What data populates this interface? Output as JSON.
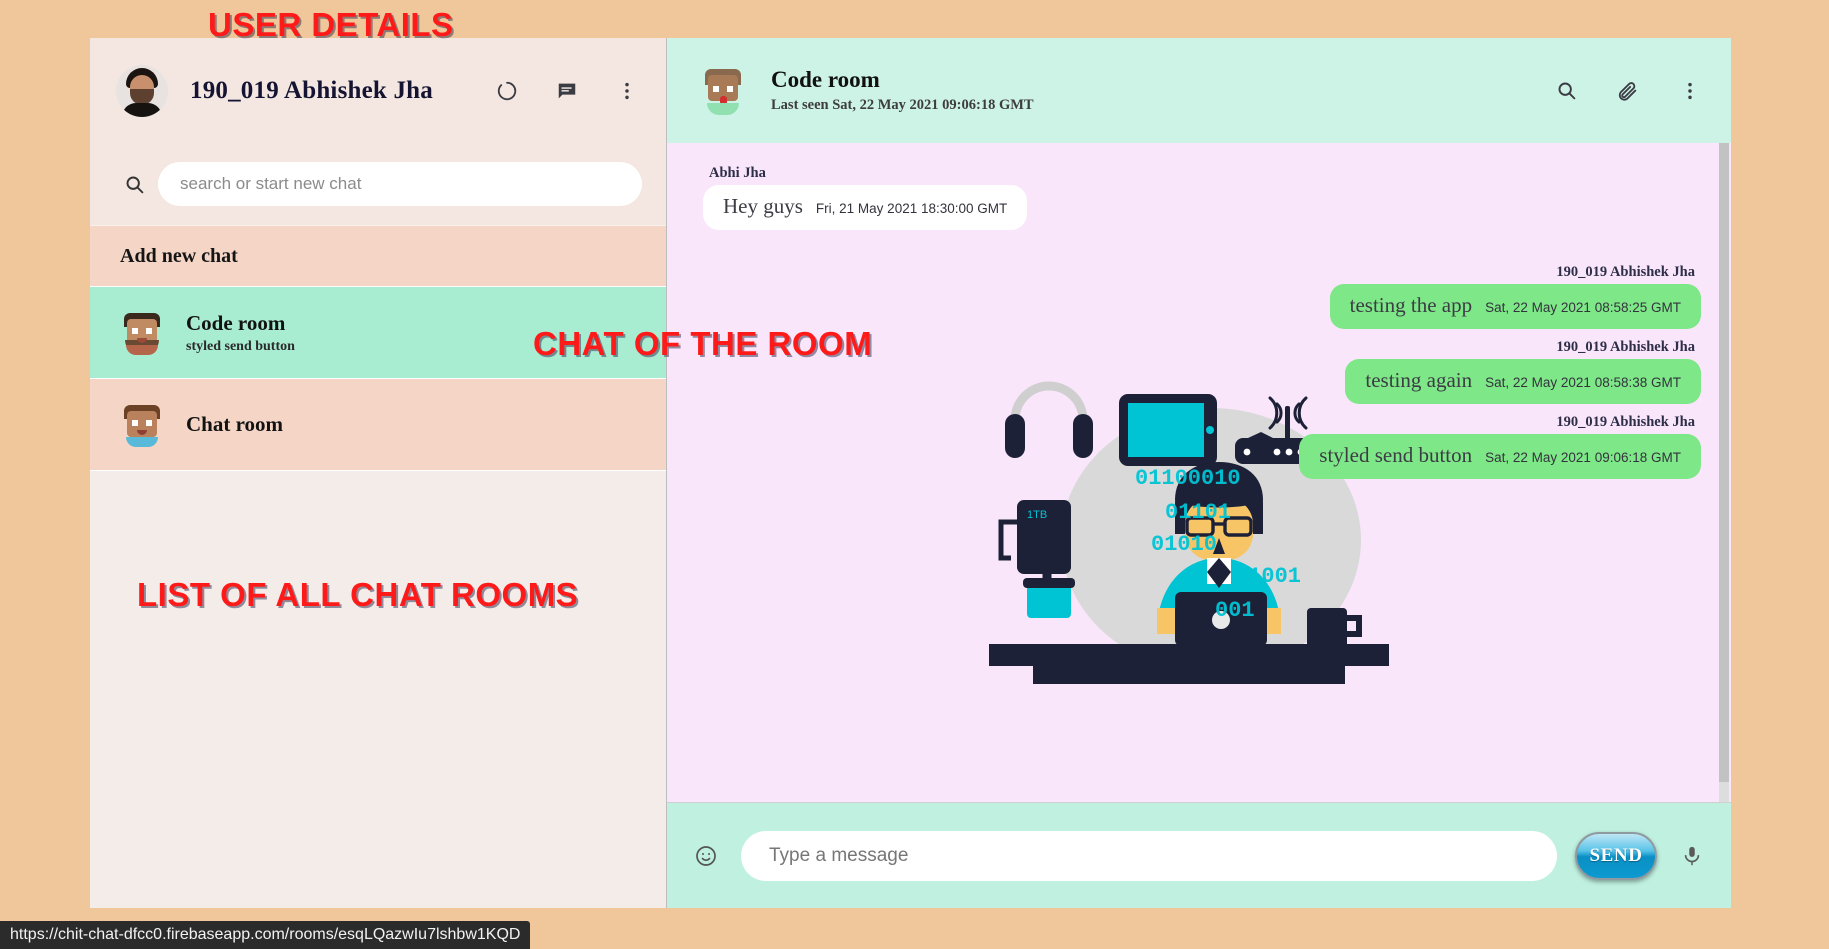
{
  "sidebar": {
    "user": {
      "name": "190_019 Abhishek Jha",
      "avatar_icon": "user-photo-avatar"
    },
    "header_icons": [
      {
        "name": "status-ring-icon",
        "glyph": "status-ring"
      },
      {
        "name": "chat-icon",
        "glyph": "chat-bubble"
      },
      {
        "name": "more-options-icon",
        "glyph": "three-dots-vertical"
      }
    ],
    "search": {
      "placeholder": "search or start new chat",
      "value": "",
      "icon": "search-icon"
    },
    "add_new_chat_label": "Add new chat",
    "rooms": [
      {
        "name": "Code room",
        "subtitle": "styled send button",
        "active": true
      },
      {
        "name": "Chat room",
        "subtitle": "",
        "active": false
      }
    ]
  },
  "chat": {
    "title": "Code room",
    "last_seen": "Last seen Sat, 22 May 2021 09:06:18 GMT",
    "header_icons": [
      {
        "name": "search-icon",
        "glyph": "magnifier"
      },
      {
        "name": "attachment-icon",
        "glyph": "paperclip"
      },
      {
        "name": "more-options-icon",
        "glyph": "three-dots-vertical"
      }
    ],
    "messages": [
      {
        "sender": "Abhi Jha",
        "text": "Hey guys",
        "time": "Fri, 21 May 2021 18:30:00 GMT",
        "direction": "in"
      },
      {
        "sender": "190_019 Abhishek Jha",
        "text": "testing the app",
        "time": "Sat, 22 May 2021 08:58:25 GMT",
        "direction": "out"
      },
      {
        "sender": "190_019 Abhishek Jha",
        "text": "testing again",
        "time": "Sat, 22 May 2021 08:58:38 GMT",
        "direction": "out"
      },
      {
        "sender": "190_019 Abhishek Jha",
        "text": "styled send button",
        "time": "Sat, 22 May 2021 09:06:18 GMT",
        "direction": "out"
      }
    ],
    "composer": {
      "emoji_icon": "emoji-smiley-icon",
      "placeholder": "Type a message",
      "value": "",
      "send_label": "SEND",
      "mic_icon": "microphone-icon"
    }
  },
  "annotations": [
    {
      "id": "user-details",
      "text": "USER DETAILS"
    },
    {
      "id": "chat-of-the-room",
      "text": "CHAT OF THE ROOM"
    },
    {
      "id": "list-of-all-chat-rooms",
      "text": "LIST OF ALL CHAT ROOMS"
    }
  ],
  "statusbar": {
    "url": "https://chit-chat-dfcc0.firebaseapp.com/rooms/esqLQazwIu7lshbw1KQD"
  },
  "colors": {
    "page_background": "#f0c79a",
    "sidebar_background": "#f4e7e1",
    "room_item": "#f5d6c6",
    "room_item_active": "#a8ecd2",
    "chat_header": "#cdf2e6",
    "messages_background": "#fae6fb",
    "bubble_out": "#7ee787",
    "bubble_in": "#ffffff",
    "composer_background": "#bff0e0",
    "send_button": "#0a8fc4",
    "annotation_red": "#ff1a1a"
  }
}
